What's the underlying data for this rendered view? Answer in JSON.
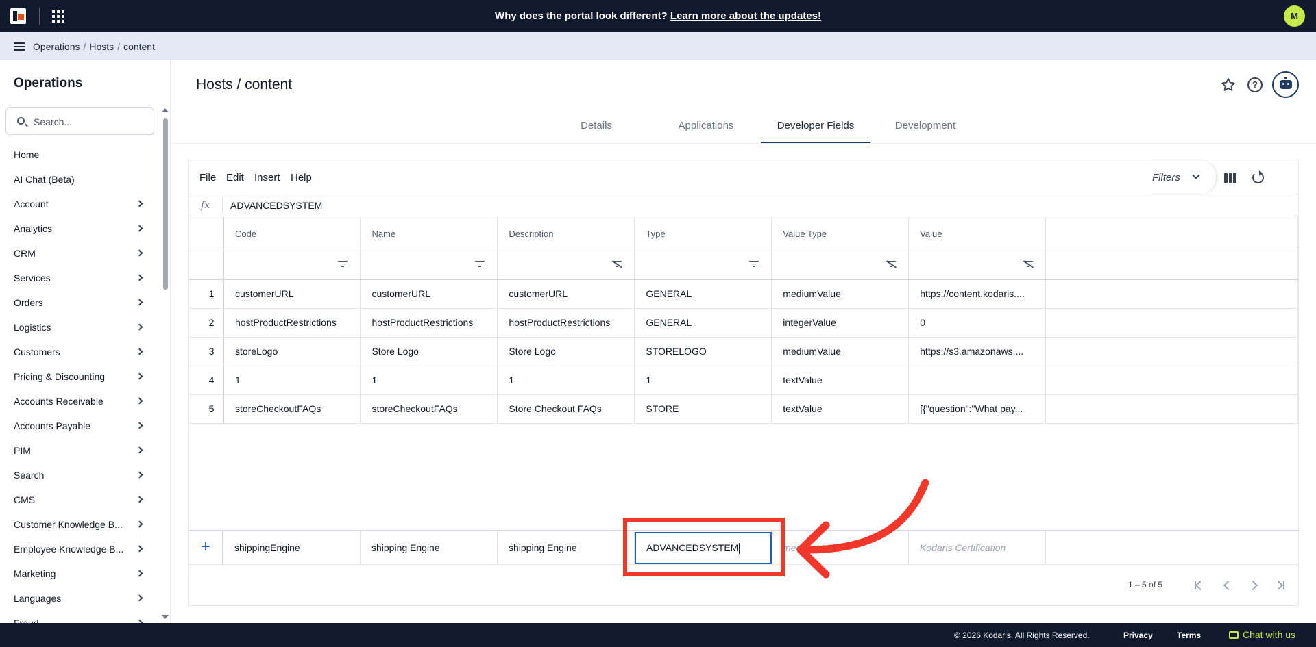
{
  "topbar": {
    "banner_text": "Why does the portal look different?",
    "banner_link": "Learn more about the updates!",
    "avatar_initial": "M"
  },
  "breadcrumb": {
    "items": [
      "Operations",
      "Hosts",
      "content"
    ]
  },
  "sidebar": {
    "title": "Operations",
    "search_placeholder": "Search...",
    "items": [
      {
        "label": "Home",
        "has_chevron": false
      },
      {
        "label": "AI Chat (Beta)",
        "has_chevron": false
      },
      {
        "label": "Account",
        "has_chevron": true
      },
      {
        "label": "Analytics",
        "has_chevron": true
      },
      {
        "label": "CRM",
        "has_chevron": true
      },
      {
        "label": "Services",
        "has_chevron": true
      },
      {
        "label": "Orders",
        "has_chevron": true
      },
      {
        "label": "Logistics",
        "has_chevron": true
      },
      {
        "label": "Customers",
        "has_chevron": true
      },
      {
        "label": "Pricing & Discounting",
        "has_chevron": true
      },
      {
        "label": "Accounts Receivable",
        "has_chevron": true
      },
      {
        "label": "Accounts Payable",
        "has_chevron": true
      },
      {
        "label": "PIM",
        "has_chevron": true
      },
      {
        "label": "Search",
        "has_chevron": true
      },
      {
        "label": "CMS",
        "has_chevron": true
      },
      {
        "label": "Customer Knowledge B...",
        "has_chevron": true
      },
      {
        "label": "Employee Knowledge B...",
        "has_chevron": true
      },
      {
        "label": "Marketing",
        "has_chevron": true
      },
      {
        "label": "Languages",
        "has_chevron": true
      },
      {
        "label": "Fraud",
        "has_chevron": true
      }
    ]
  },
  "main": {
    "title": "Hosts / content",
    "help_glyph": "?",
    "tabs": [
      {
        "label": "Details",
        "active": false
      },
      {
        "label": "Applications",
        "active": false
      },
      {
        "label": "Developer Fields",
        "active": true
      },
      {
        "label": "Development",
        "active": false
      }
    ]
  },
  "grid": {
    "menu": [
      "File",
      "Edit",
      "Insert",
      "Help"
    ],
    "filters_label": "Filters",
    "fx_label": "fx",
    "fx_value": "ADVANCEDSYSTEM",
    "columns": [
      "Code",
      "Name",
      "Description",
      "Type",
      "Value Type",
      "Value"
    ],
    "column_filter_disabled": [
      false,
      false,
      true,
      false,
      true,
      true
    ],
    "rows": [
      {
        "index": "1",
        "cells": [
          "customerURL",
          "customerURL",
          "customerURL",
          "GENERAL",
          "mediumValue",
          "https://content.kodaris...."
        ]
      },
      {
        "index": "2",
        "cells": [
          "hostProductRestrictions",
          "hostProductRestrictions",
          "hostProductRestrictions",
          "GENERAL",
          "integerValue",
          "0"
        ]
      },
      {
        "index": "3",
        "cells": [
          "storeLogo",
          "Store Logo",
          "Store Logo",
          "STORELOGO",
          "mediumValue",
          "https://s3.amazonaws...."
        ]
      },
      {
        "index": "4",
        "cells": [
          "1",
          "1",
          "1",
          "1",
          "textValue",
          ""
        ]
      },
      {
        "index": "5",
        "cells": [
          "storeCheckoutFAQs",
          "storeCheckoutFAQs",
          "Store Checkout FAQs",
          "STORE",
          "textValue",
          "[{\"question\":\"What pay..."
        ]
      }
    ],
    "new_row": {
      "plus": "+",
      "code": "shippingEngine",
      "name": "shipping Engine",
      "description": "shipping Engine",
      "type_value": "ADVANCEDSYSTEM",
      "value_type_placeholder": "mediumValue",
      "value_placeholder": "Kodaris Certification"
    },
    "pagination": "1 – 5 of 5"
  },
  "annotation": {
    "color": "#f1362a"
  },
  "footer": {
    "copyright": "© 2026 Kodaris. All Rights Reserved.",
    "privacy": "Privacy",
    "terms": "Terms",
    "chat": "Chat with us"
  }
}
